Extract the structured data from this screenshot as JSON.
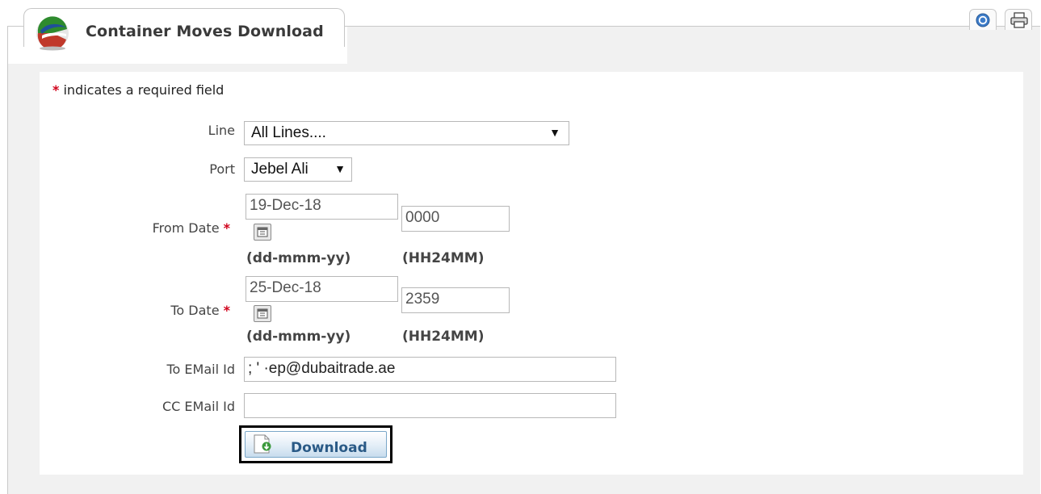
{
  "header": {
    "title": "Container Moves Download",
    "help_icon": "help-icon",
    "print_icon": "printer-icon"
  },
  "form": {
    "required_note_star": "*",
    "required_note": "indicates a required field",
    "line": {
      "label": "Line",
      "value": "All Lines...."
    },
    "port": {
      "label": "Port",
      "value": "Jebel Ali"
    },
    "from_date": {
      "label": "From Date",
      "date": "19-Dec-18",
      "time": "0000",
      "date_hint": "(dd-mmm-yy)",
      "time_hint": "(HH24MM)"
    },
    "to_date": {
      "label": "To Date",
      "date": "25-Dec-18",
      "time": "2359",
      "date_hint": "(dd-mmm-yy)",
      "time_hint": "(HH24MM)"
    },
    "to_email": {
      "label": "To EMail Id",
      "value": ";              '  ·ep@dubaitrade.ae"
    },
    "cc_email": {
      "label": "CC EMail Id",
      "value": ""
    },
    "star": "*"
  },
  "actions": {
    "download_label": "Download"
  },
  "colors": {
    "required": "#d0021b",
    "button_text": "#2a5a86"
  }
}
